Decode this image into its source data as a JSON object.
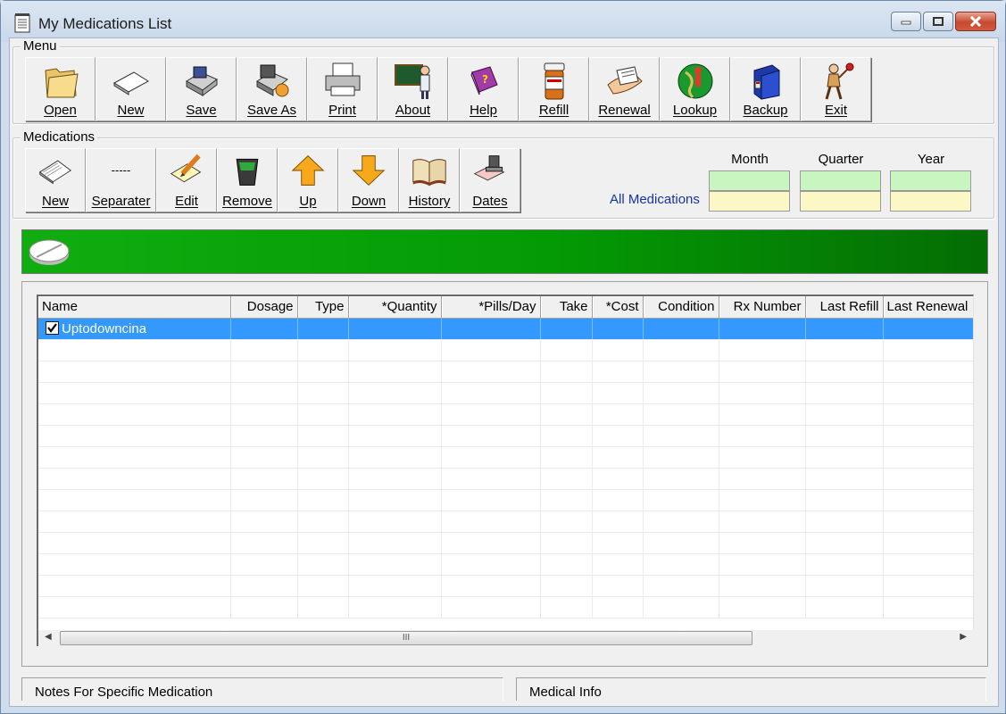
{
  "window": {
    "title": "My Medications List"
  },
  "menu": {
    "label": "Menu",
    "buttons": [
      {
        "label": "Open",
        "icon": "folder-icon"
      },
      {
        "label": "New",
        "icon": "new-document-icon"
      },
      {
        "label": "Save",
        "icon": "floppy-save-icon"
      },
      {
        "label": "Save As",
        "icon": "save-as-icon"
      },
      {
        "label": "Print",
        "icon": "printer-icon"
      },
      {
        "label": "About",
        "icon": "teacher-board-icon"
      },
      {
        "label": "Help",
        "icon": "help-book-icon"
      },
      {
        "label": "Refill",
        "icon": "pill-bottle-icon"
      },
      {
        "label": "Renewal",
        "icon": "prescription-hand-icon"
      },
      {
        "label": "Lookup",
        "icon": "globe-icon"
      },
      {
        "label": "Backup",
        "icon": "backup-icon"
      },
      {
        "label": "Exit",
        "icon": "exit-icon"
      }
    ]
  },
  "medications": {
    "label": "Medications",
    "buttons": [
      {
        "label": "New",
        "icon": "new-med-icon"
      },
      {
        "label": "Separater",
        "icon": "separator-dashes-icon",
        "glyph": "-----"
      },
      {
        "label": "Edit",
        "icon": "edit-pencil-icon"
      },
      {
        "label": "Remove",
        "icon": "trash-can-icon"
      },
      {
        "label": "Up",
        "icon": "arrow-up-icon"
      },
      {
        "label": "Down",
        "icon": "arrow-down-icon"
      },
      {
        "label": "History",
        "icon": "open-book-icon"
      },
      {
        "label": "Dates",
        "icon": "stamp-icon"
      }
    ],
    "all_label": "All Medications",
    "periods": [
      "Month",
      "Quarter",
      "Year"
    ]
  },
  "table": {
    "columns": [
      "Name",
      "Dosage",
      "Type",
      "*Quantity",
      "*Pills/Day",
      "Take",
      "*Cost",
      "Condition",
      "Rx Number",
      "Last Refill",
      "Last Renewal"
    ],
    "rows": [
      {
        "checked": true,
        "name": "Uptodowncina",
        "selected": true
      }
    ],
    "scroll_grip": "III"
  },
  "footer": {
    "notes_label": "Notes For Specific Medication",
    "info_label": "Medical Info"
  },
  "colors": {
    "banner": "#049a04",
    "selection": "#3399ff",
    "period_top": "#c8f5c0",
    "period_bottom": "#fbf8c6",
    "link": "#1732a8"
  }
}
